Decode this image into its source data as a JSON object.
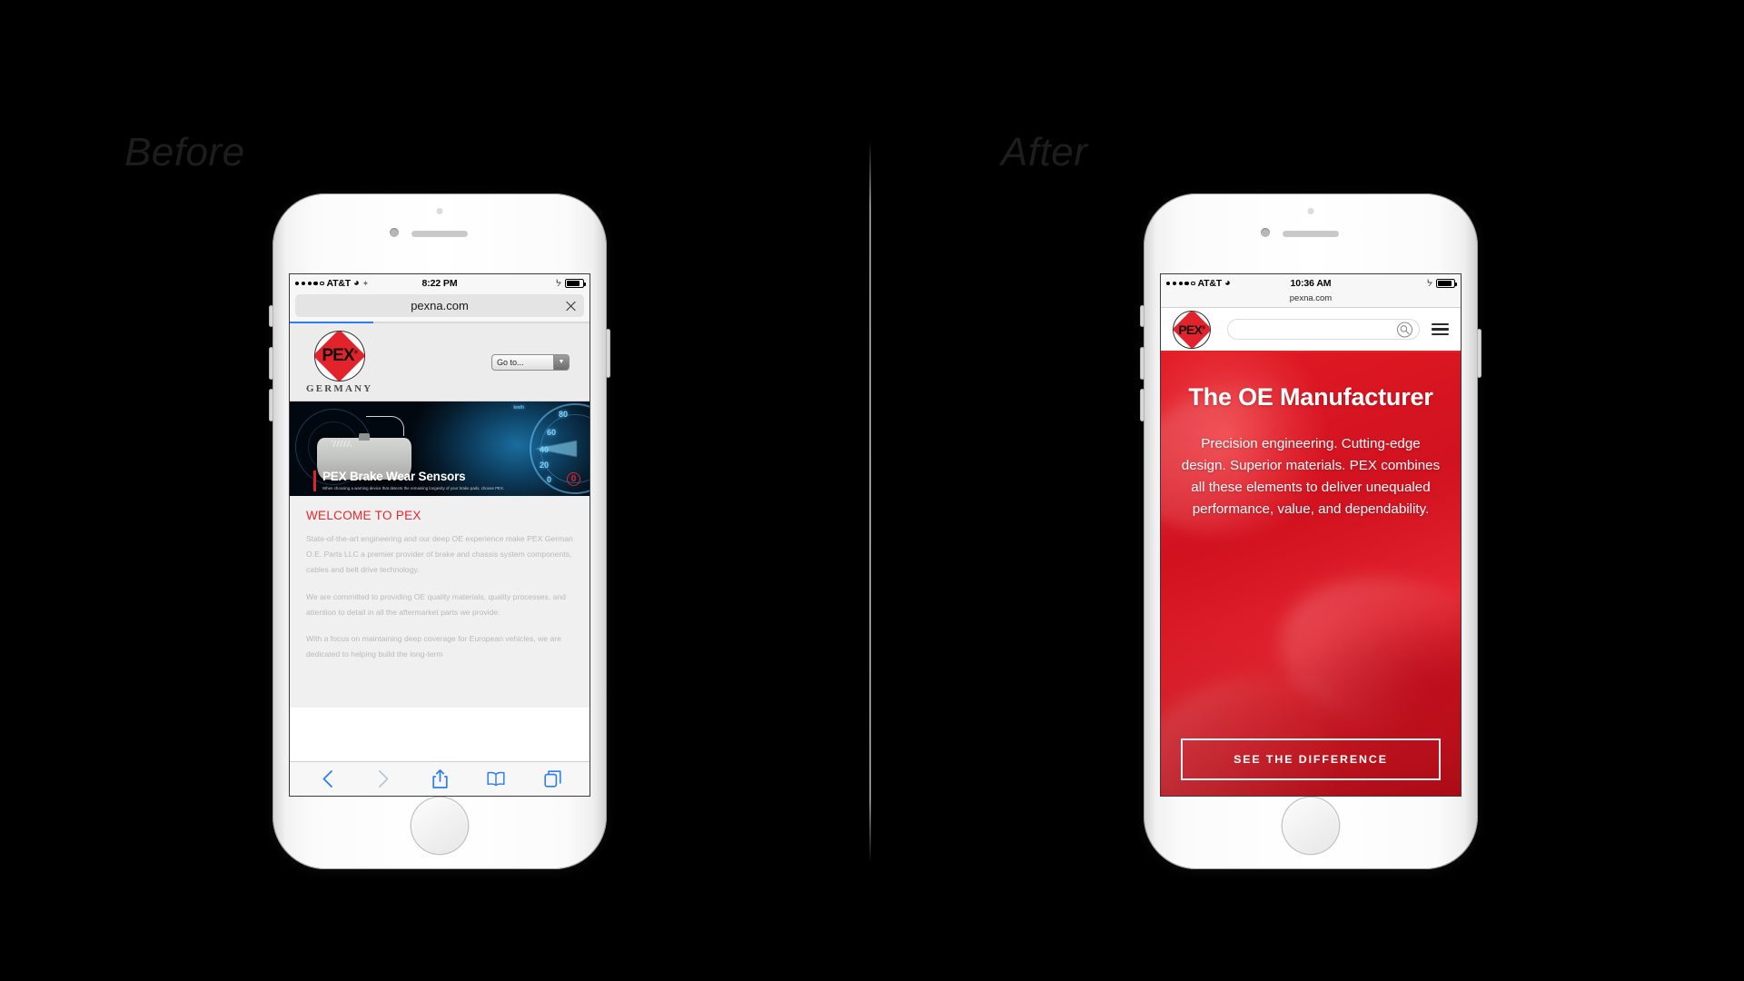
{
  "labels": {
    "before": "Before",
    "after": "After"
  },
  "before": {
    "statusbar": {
      "carrier": "AT&T",
      "time": "8:22 PM",
      "wifi_icon": "wifi-icon",
      "location_icon": "location-arrow-icon",
      "bluetooth_icon": "bluetooth-icon",
      "battery_icon": "battery-icon"
    },
    "browser": {
      "url": "pexna.com",
      "stop_icon": "close-icon",
      "progress_percent": 28,
      "toolbar": {
        "back_icon": "chevron-left-icon",
        "forward_icon": "chevron-right-icon",
        "share_icon": "share-icon",
        "bookmarks_icon": "book-icon",
        "tabs_icon": "tabs-icon"
      }
    },
    "site": {
      "logo_word": "PEX",
      "logo_registered": "®",
      "logo_subtitle": "GERMANY",
      "goto_label": "Go to...",
      "goto_arrow": "▼",
      "hero": {
        "title": "PEX Brake Wear Sensors",
        "subtitle": "When choosing a warning device that detects the remaining longevity of your brake pads, choose PEX.",
        "badge": "0",
        "gauge_numbers": [
          "80",
          "60",
          "40",
          "20",
          "0"
        ],
        "gauge_unit": "km/h"
      },
      "heading": "WELCOME TO PEX",
      "paragraphs": [
        "State-of-the-art engineering and our deep OE experience make PEX German O.E. Parts LLC a premier provider of brake and chassis system components, cables and belt drive technology.",
        "We are committed to providing OE quality materials, quality processes, and attention to detail in all the aftermarket parts we provide.",
        "With a focus on maintaining deep coverage for European vehicles, we are dedicated to helping build the long-term"
      ]
    }
  },
  "after": {
    "statusbar": {
      "carrier": "AT&T",
      "time": "10:36 AM",
      "wifi_icon": "wifi-icon",
      "bluetooth_icon": "bluetooth-icon",
      "battery_icon": "battery-icon"
    },
    "browser": {
      "url": "pexna.com"
    },
    "site": {
      "logo_word": "PEX",
      "logo_registered": "®",
      "search_placeholder": "",
      "search_icon": "search-icon",
      "menu_icon": "hamburger-menu-icon",
      "hero": {
        "title": "The OE Manufacturer",
        "body": "Precision engineering. Cutting-edge design. Superior materials. PEX combines all these elements to deliver unequaled performance, value, and dependability.",
        "cta_label": "SEE THE DIFFERENCE"
      }
    }
  },
  "colors": {
    "background": "#000000",
    "brand_red": "#e2232c",
    "hero_red": "#d1121f",
    "safari_blue": "#2d7df6",
    "label_gray": "#1d1d1d"
  }
}
